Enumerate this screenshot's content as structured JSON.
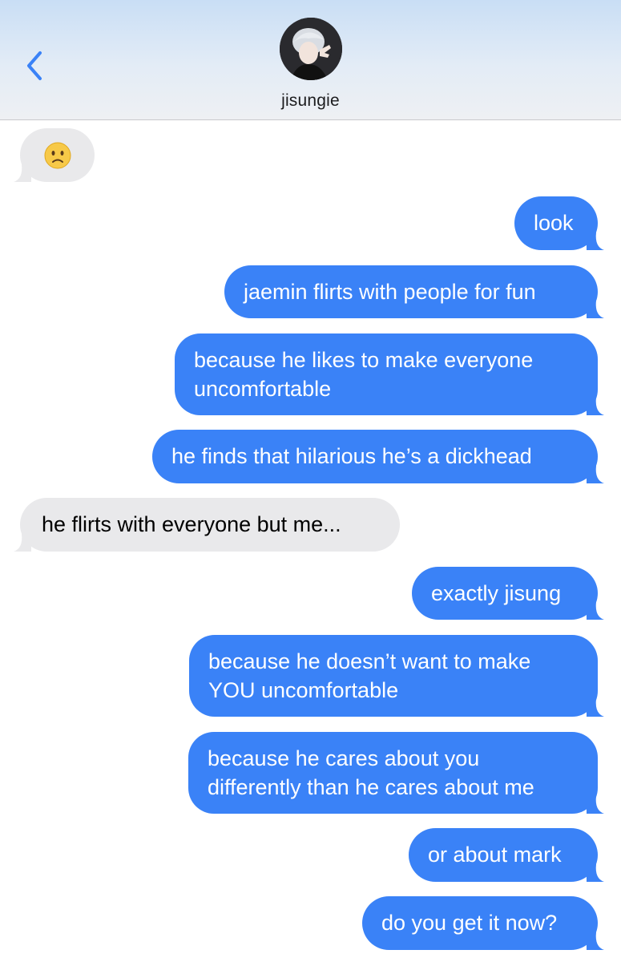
{
  "header": {
    "back_icon": "chevron-left-icon",
    "contact_name": "jisungie",
    "accent_color": "#3a82f7"
  },
  "messages": [
    {
      "direction": "received",
      "text": "",
      "emoji": "slightly-frowning-face"
    },
    {
      "direction": "sent",
      "text": "look"
    },
    {
      "direction": "sent",
      "text": "jaemin flirts with people for fun"
    },
    {
      "direction": "sent",
      "lines": [
        "because he likes to make everyone",
        "uncomfortable"
      ]
    },
    {
      "direction": "sent",
      "text": "he finds that hilarious he’s a dickhead"
    },
    {
      "direction": "received",
      "text": "he flirts with everyone but me..."
    },
    {
      "direction": "sent",
      "text": "exactly jisung"
    },
    {
      "direction": "sent",
      "lines": [
        "because he doesn’t want to make",
        "YOU uncomfortable"
      ]
    },
    {
      "direction": "sent",
      "lines": [
        "because he cares about you",
        "differently than he cares about me"
      ]
    },
    {
      "direction": "sent",
      "text": "or about mark"
    },
    {
      "direction": "sent",
      "text": "do you get it now?"
    }
  ],
  "colors": {
    "sent_bubble": "#3a82f7",
    "received_bubble": "#e9e9eb"
  }
}
